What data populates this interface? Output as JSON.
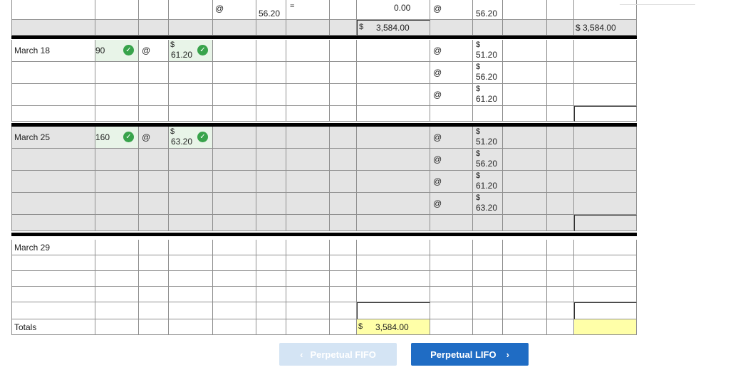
{
  "top_row": {
    "at": "@",
    "cost": "56.20",
    "eq": "=",
    "total": "0.00",
    "bal_at": "@",
    "bal_cost": "56.20"
  },
  "subtotal_row": {
    "cur": "$",
    "total": "3,584.00",
    "balance": "$ 3,584.00"
  },
  "rows": [
    {
      "label": "March 18",
      "qty": "90",
      "at": "@",
      "cur": "$",
      "cost": "61.20",
      "balance": [
        {
          "at": "@",
          "cur": "$",
          "cost": "51.20"
        },
        {
          "at": "@",
          "cur": "$",
          "cost": "56.20"
        },
        {
          "at": "@",
          "cur": "$",
          "cost": "61.20"
        }
      ]
    },
    {
      "label": "March 25",
      "qty": "160",
      "at": "@",
      "cur": "$",
      "cost": "63.20",
      "balance": [
        {
          "at": "@",
          "cur": "$",
          "cost": "51.20"
        },
        {
          "at": "@",
          "cur": "$",
          "cost": "56.20"
        },
        {
          "at": "@",
          "cur": "$",
          "cost": "61.20"
        },
        {
          "at": "@",
          "cur": "$",
          "cost": "63.20"
        }
      ]
    },
    {
      "label": "March 29"
    }
  ],
  "totals": {
    "label": "Totals",
    "cur": "$",
    "cost_of_goods_sold": "3,584.00"
  },
  "nav": {
    "prev": "Perpetual FIFO",
    "next": "Perpetual LIFO",
    "prev_chevron": "‹",
    "next_chevron": "›"
  },
  "status_icon": "check-icon",
  "colors": {
    "gray_fill": "#e4e4e4",
    "answer_yellow": "#ffffa8",
    "correct_green": "#38a34b",
    "button_blue": "#1f6cc4",
    "button_disabled": "#d4e4f4"
  }
}
